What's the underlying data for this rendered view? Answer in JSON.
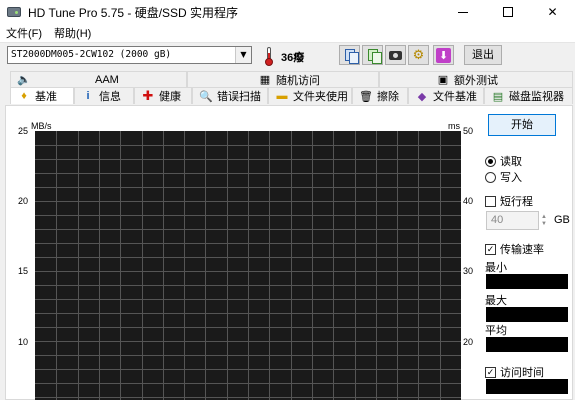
{
  "window": {
    "title": "HD Tune Pro 5.75 - 硬盘/SSD 实用程序",
    "icon": "disk-icon"
  },
  "menu": [
    "文件(F)",
    "帮助(H)"
  ],
  "toolbar": {
    "drive": "ST2000DM005-2CW102 (2000 gB)",
    "temperature": "36癈",
    "exit_label": "退出",
    "buttons": [
      "copy-text-icon",
      "copy-screen-icon",
      "screenshot-icon",
      "options-icon",
      "save-icon"
    ]
  },
  "tabs": {
    "row1": [
      {
        "label": "AAM",
        "icon": "speaker-icon"
      },
      {
        "label": "随机访问",
        "icon": "random-access-icon"
      },
      {
        "label": "额外测试",
        "icon": "extra-tests-icon"
      }
    ],
    "row2": [
      {
        "label": "基准",
        "icon": "benchmark-icon",
        "active": true
      },
      {
        "label": "信息",
        "icon": "info-icon"
      },
      {
        "label": "健康",
        "icon": "health-icon"
      },
      {
        "label": "错误扫描",
        "icon": "error-scan-icon"
      },
      {
        "label": "文件夹使用",
        "icon": "folder-icon"
      },
      {
        "label": "擦除",
        "icon": "erase-icon"
      },
      {
        "label": "文件基准",
        "icon": "file-benchmark-icon"
      },
      {
        "label": "磁盘监视器",
        "icon": "disk-monitor-icon"
      }
    ]
  },
  "chart": {
    "left_unit": "MB/s",
    "right_unit": "ms",
    "left_ticks": [
      "25",
      "20",
      "15",
      "10"
    ],
    "right_ticks": [
      "50",
      "40",
      "30",
      "20"
    ]
  },
  "panel": {
    "start_label": "开始",
    "read_label": "读取",
    "write_label": "写入",
    "mode": "read",
    "short_stroke_label": "短行程",
    "short_stroke_checked": false,
    "short_stroke_value": "40",
    "unit": "GB",
    "transfer_rate_label": "传输速率",
    "transfer_rate_checked": true,
    "min_label": "最小",
    "max_label": "最大",
    "avg_label": "平均",
    "access_time_label": "访问时间",
    "access_time_checked": true
  },
  "colors": {
    "chart_bg": "#1a1a1a",
    "grid": "#555555",
    "accent": "#0078d7"
  }
}
